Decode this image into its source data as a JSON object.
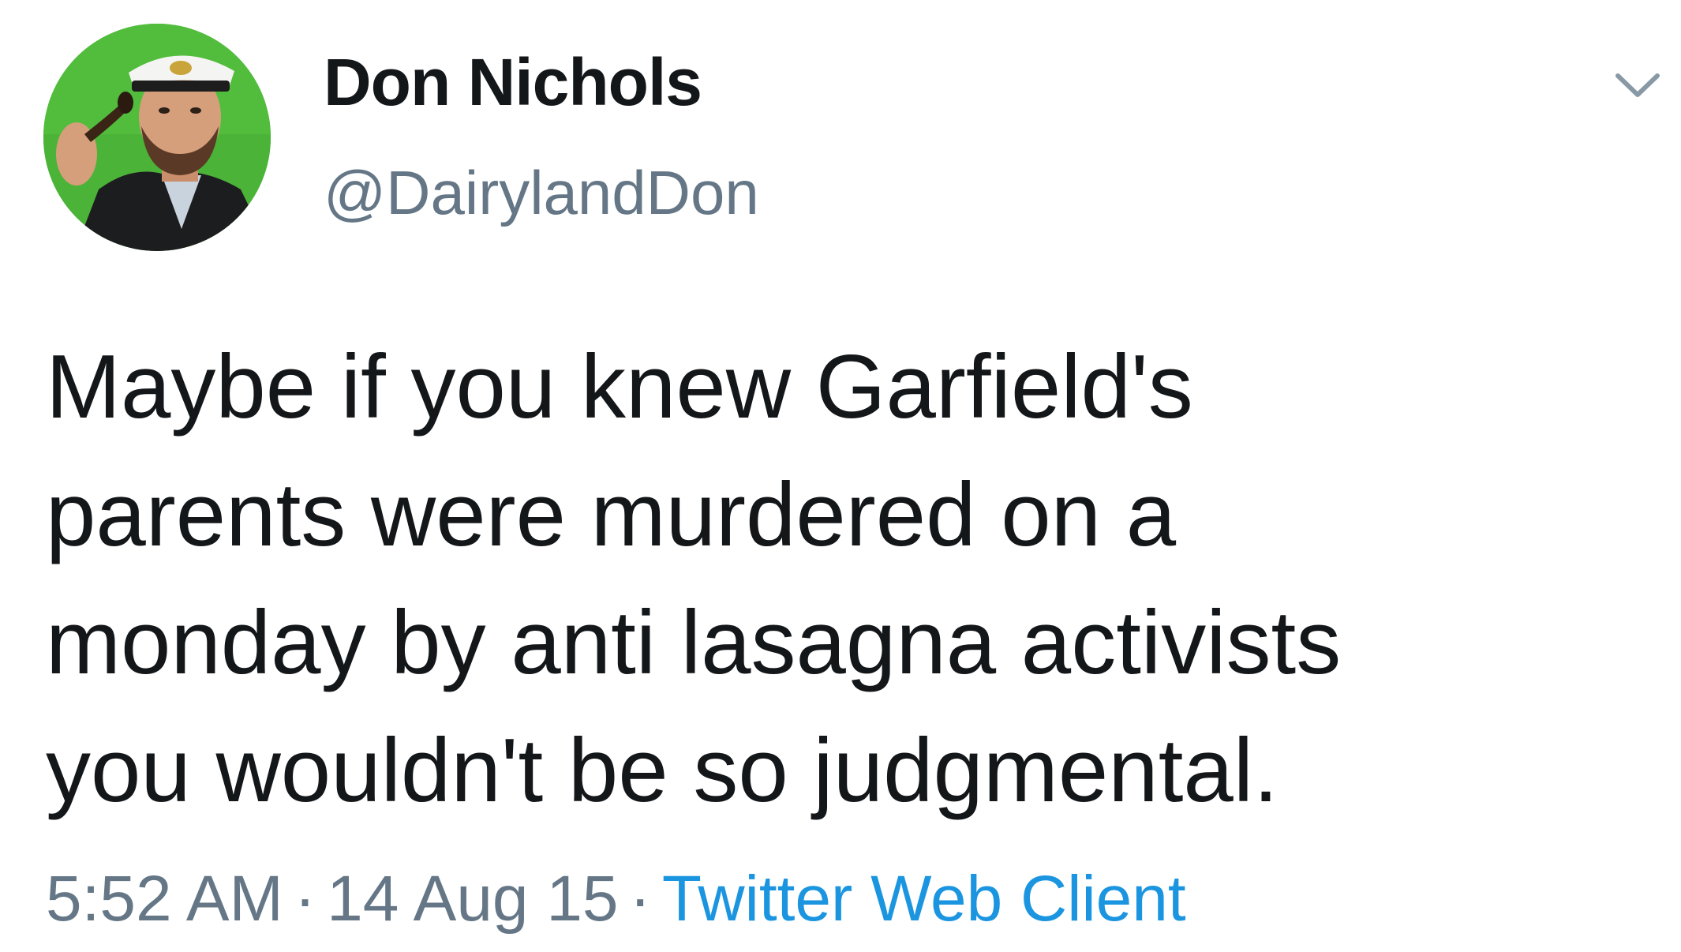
{
  "author": {
    "display_name": "Don Nichols",
    "handle": "@DairylandDon"
  },
  "tweet": {
    "lines": [
      "Maybe if you knew Garfield's",
      "parents were murdered on a",
      "monday by anti lasagna activists",
      "you wouldn't be so judgmental."
    ]
  },
  "meta": {
    "time": "5:52 AM",
    "separator": "·",
    "date": "14 Aug 15",
    "client": "Twitter Web Client"
  },
  "icons": {
    "more": "chevron-down-icon"
  },
  "colors": {
    "text": "#14171a",
    "secondary": "#657786",
    "link": "#1b95e0",
    "avatar_background": "#4bb338"
  }
}
